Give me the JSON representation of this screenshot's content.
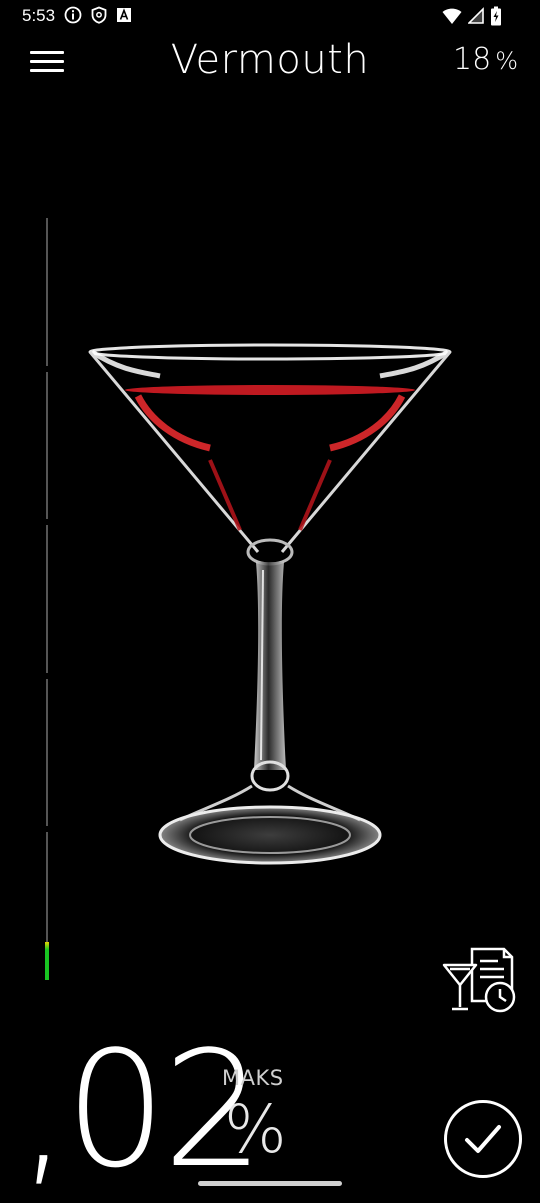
{
  "status_bar": {
    "time": "5:53",
    "left_icons": [
      "info-icon",
      "shield-icon",
      "a-box-icon"
    ],
    "right_icons": [
      "wifi-icon",
      "cell-signal-icon",
      "battery-charging-icon"
    ]
  },
  "app_bar": {
    "menu_icon": "hamburger-menu-icon",
    "title": "Vermouth",
    "abv_value": "18",
    "abv_unit": "%"
  },
  "gauge": {
    "segments": 5,
    "level": 0.05,
    "colors": {
      "fill_low": "#19c522",
      "fill_top": "#e6d400",
      "track": "#555555"
    }
  },
  "drink_image": {
    "icon": "martini-glass-illustration",
    "liquid_color": "#d41c24"
  },
  "history_button": {
    "icon": "drink-history-icon"
  },
  "reading": {
    "value": ",02",
    "label": "MAKS",
    "unit": "%"
  },
  "confirm_button": {
    "icon": "checkmark-icon"
  }
}
